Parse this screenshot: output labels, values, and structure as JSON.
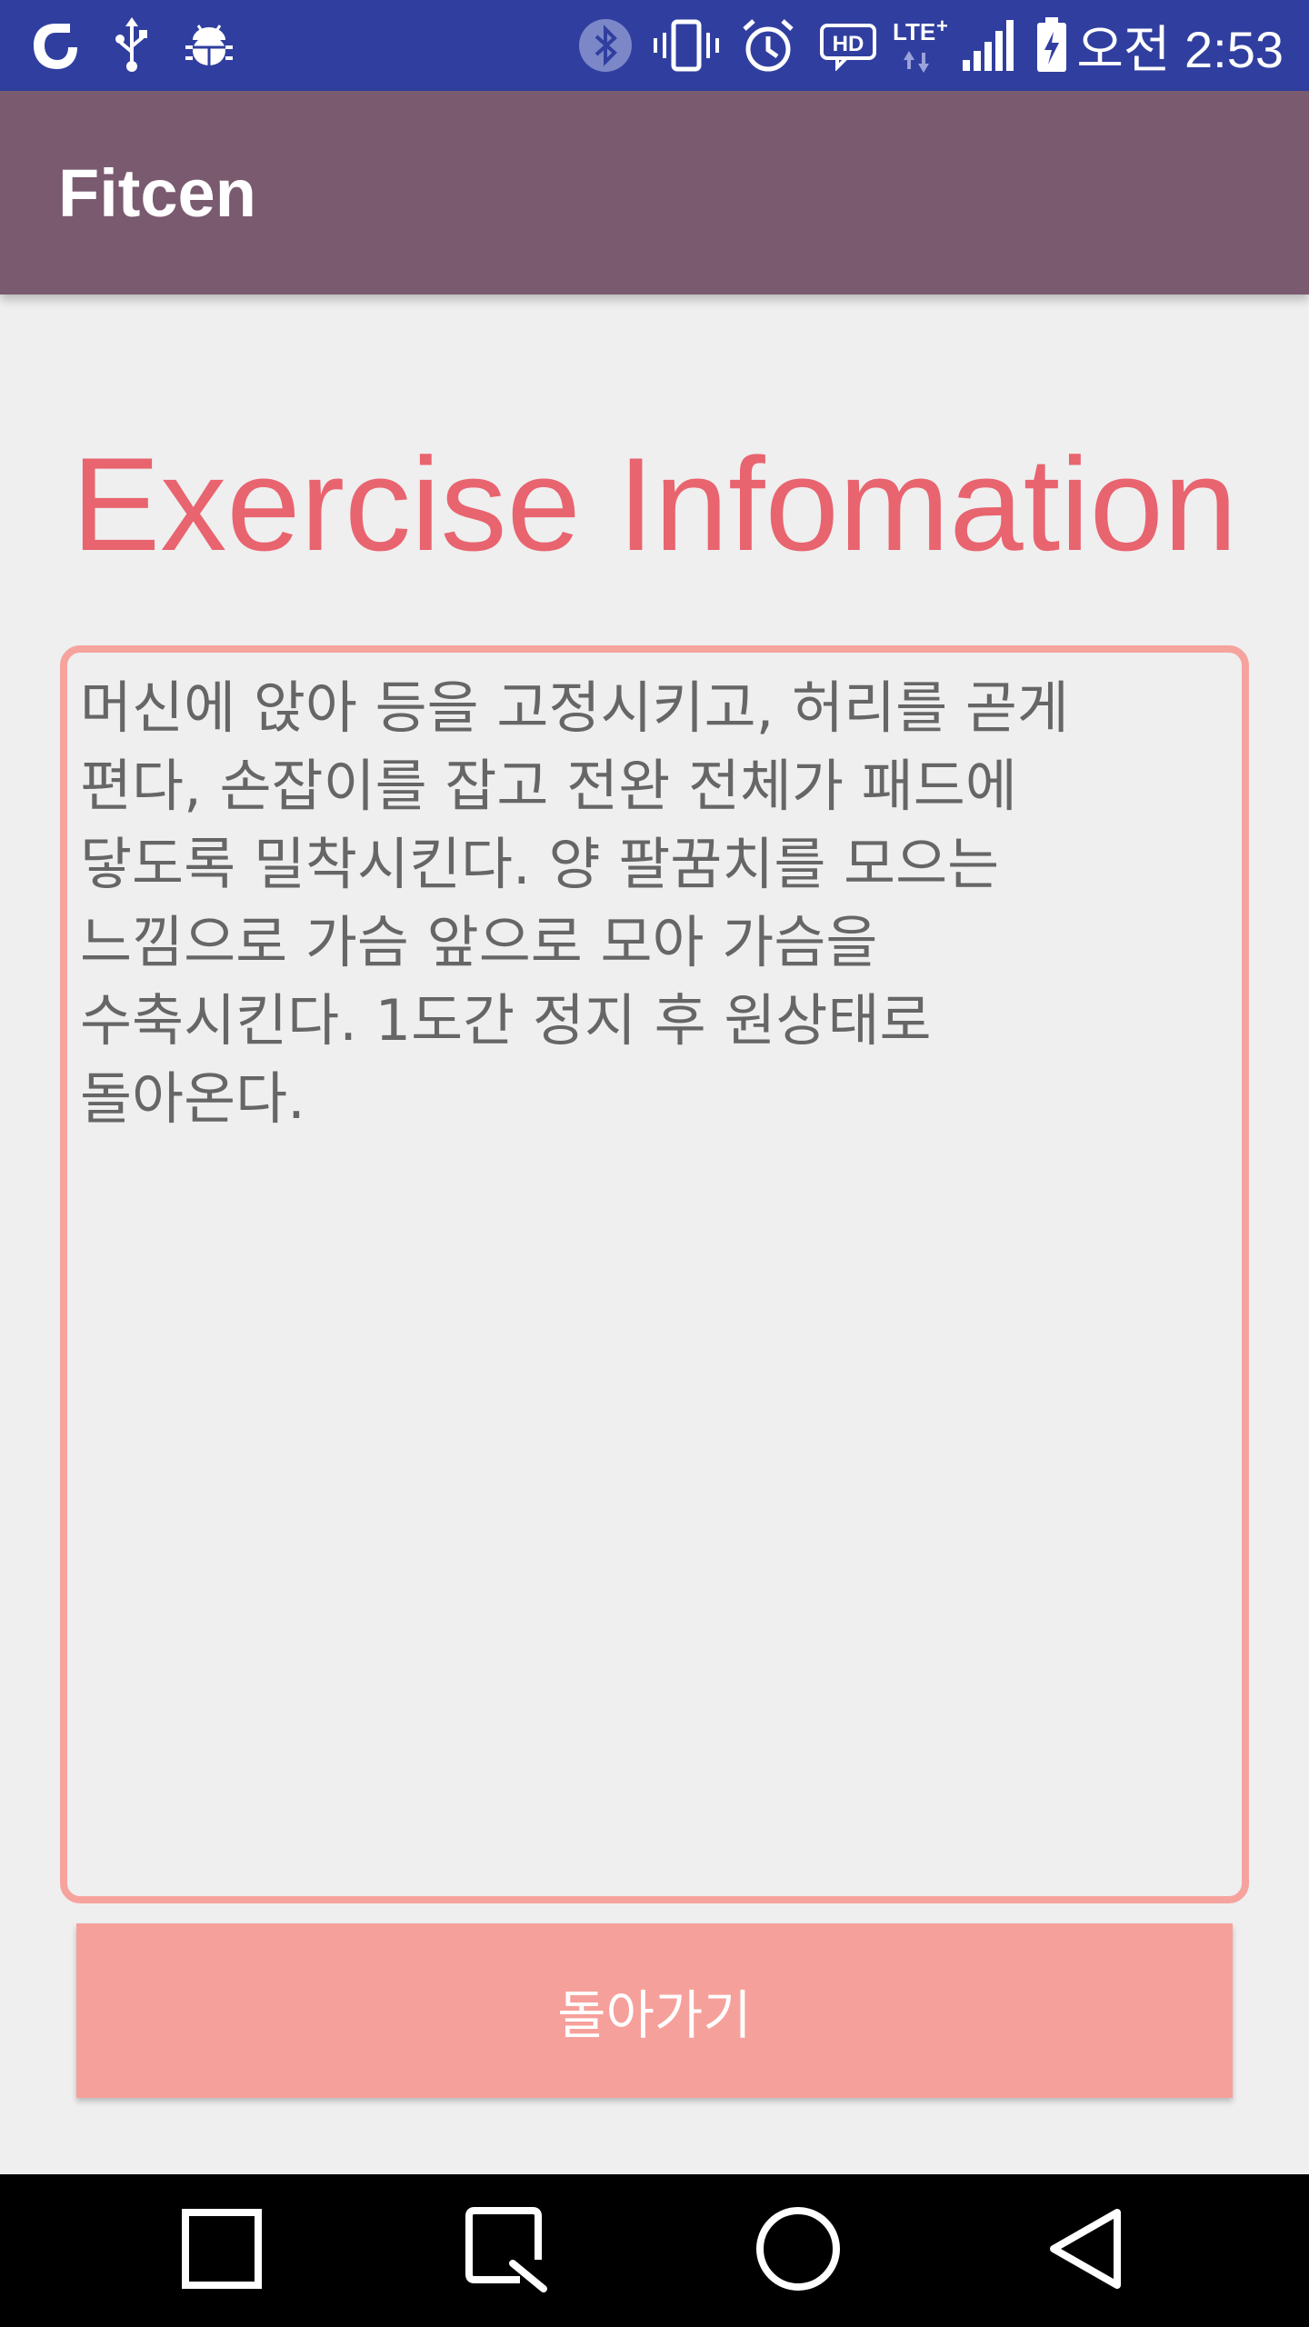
{
  "status_bar": {
    "time": "오전 2:53",
    "icons": [
      "opera-icon",
      "usb-icon",
      "android-debug-icon",
      "bluetooth-icon",
      "vibrate-icon",
      "alarm-icon",
      "hd-icon",
      "lte-icon",
      "signal-icon",
      "battery-icon"
    ],
    "background_color": "#303f9f"
  },
  "app_bar": {
    "title": "Fitcen",
    "background_color": "#7a5a6f"
  },
  "main": {
    "heading": "Exercise Infomation",
    "heading_color": "#e8646f",
    "info_text": "머신에 앉아 등을 고정시키고, 허리를 곧게\n편다, 손잡이를 잡고 전완 전체가 패드에\n닿도록 밀착시킨다. 양 팔꿈치를 모으는\n느낌으로 가슴 앞으로 모아 가슴을\n수축시킨다. 1도간 정지 후 원상태로\n돌아온다.",
    "box_border_color": "#f6a39e",
    "back_button_label": "돌아가기",
    "button_color": "#f6a09b"
  },
  "nav_bar": {
    "icons": [
      "recents-icon",
      "capture-icon",
      "home-icon",
      "back-icon"
    ]
  }
}
